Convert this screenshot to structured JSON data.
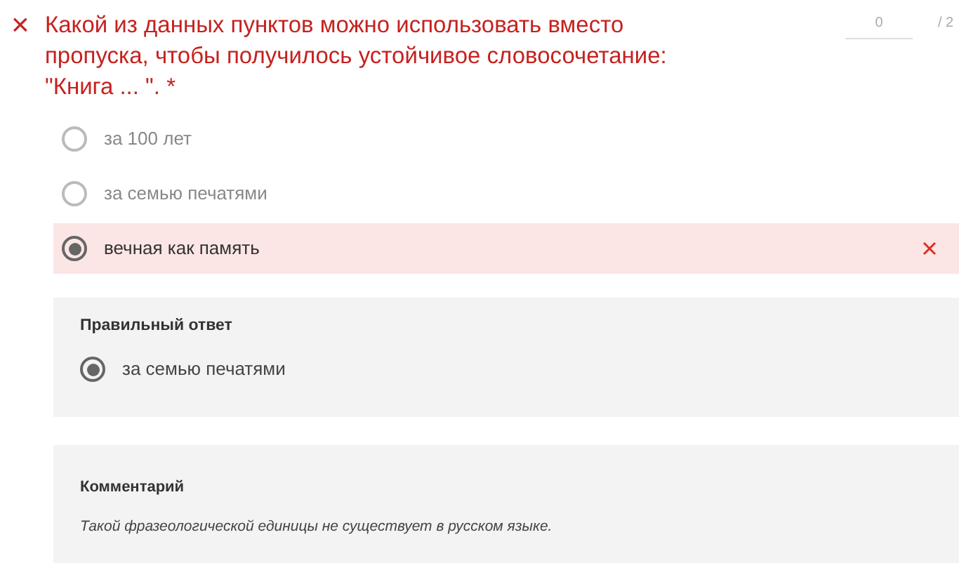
{
  "question": {
    "mark": "×",
    "text": "Какой из данных пунктов можно использовать вместо пропуска, чтобы получилось устойчивое словосочетание: \"Книга ... \". *",
    "score": "0",
    "max": "/ 2"
  },
  "options": [
    {
      "label": "за 100 лет",
      "selected": false,
      "incorrect": false
    },
    {
      "label": "за семью печатями",
      "selected": false,
      "incorrect": false
    },
    {
      "label": "вечная как память",
      "selected": true,
      "incorrect": true
    }
  ],
  "correct": {
    "title": "Правильный ответ",
    "answer": "за семью печатями",
    "selected": true
  },
  "comment": {
    "title": "Комментарий",
    "text": "Такой фразеологической единицы не существует в русском языке."
  }
}
